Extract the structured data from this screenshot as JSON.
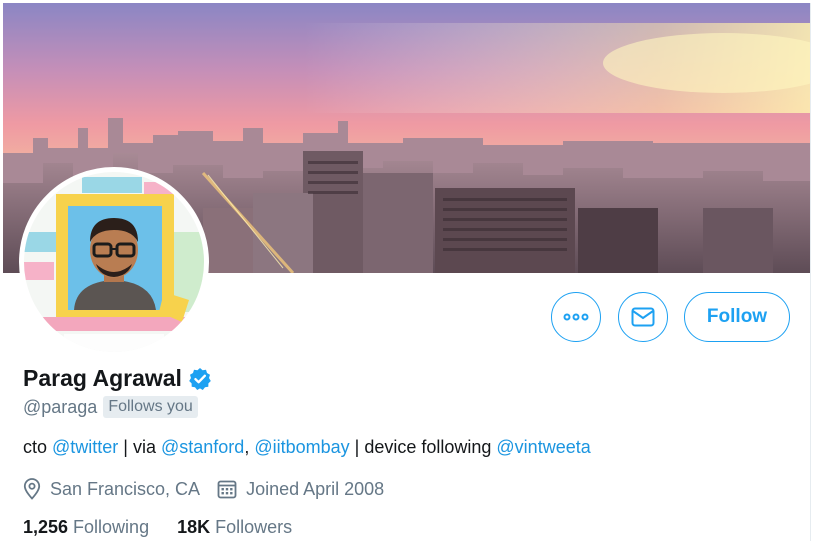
{
  "profile": {
    "name": "Parag Agrawal",
    "handle": "@paraga",
    "follows_you": "Follows you",
    "bio": {
      "t1": "cto ",
      "m1": "@twitter",
      "t2": " | via ",
      "m2": "@stanford",
      "t3": ", ",
      "m3": "@iitbombay",
      "t4": " | device following ",
      "m4": "@vintweeta"
    },
    "location": "San Francisco, CA",
    "joined": "Joined April 2008",
    "following_count": "1,256",
    "following_label": "Following",
    "followers_count": "18K",
    "followers_label": "Followers"
  },
  "actions": {
    "follow_label": "Follow"
  },
  "icons": {
    "more": "more-icon",
    "message": "envelope-icon",
    "verified": "verified-badge-icon",
    "location": "location-pin-icon",
    "calendar": "calendar-icon"
  },
  "colors": {
    "accent": "#1da1f2",
    "link": "#1b95e0",
    "secondary_text": "#657786"
  }
}
